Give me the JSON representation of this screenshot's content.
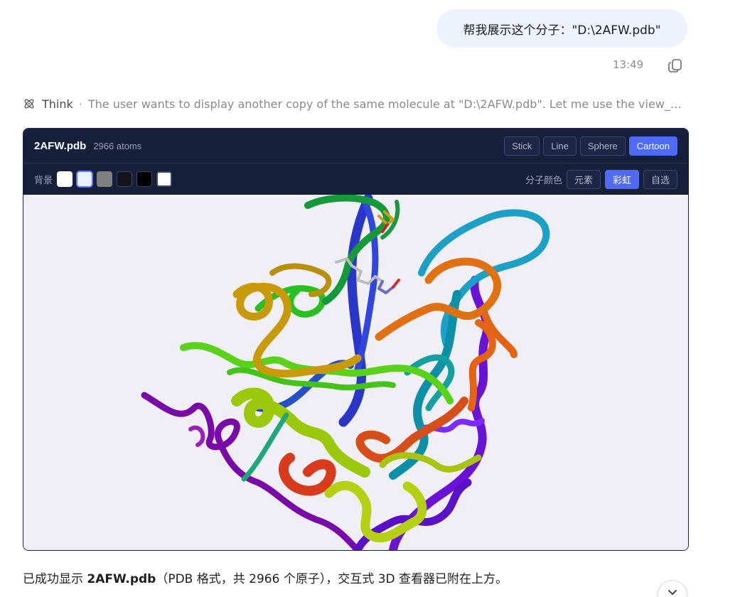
{
  "user_message": "帮我展示这个分子：\"D:\\2AFW.pdb\"",
  "message_time": "13:49",
  "think": {
    "label": "Think",
    "separator": "·",
    "text": "The user wants to display another copy of the same molecule at \"D:\\2AFW.pdb\". Let me use the view_molec..."
  },
  "viewer": {
    "filename": "2AFW.pdb",
    "atoms": "2966 atoms",
    "styles": [
      "Stick",
      "Line",
      "Sphere",
      "Cartoon"
    ],
    "active_style": "Cartoon",
    "background_label": "背景",
    "background_swatches": [
      "#ffffff",
      "#eaf0ff",
      "#808080",
      "#15151c",
      "#000000",
      "#ffffff"
    ],
    "selected_swatch_index": 1,
    "color_label": "分子颜色",
    "color_modes": [
      "元素",
      "彩虹",
      "自选"
    ],
    "active_color_mode": "彩虹"
  },
  "answer": {
    "prefix": "已成功显示 ",
    "filename": "2AFW.pdb",
    "suffix": "（PDB 格式，共 2966 个原子），交互式 3D 查看器已附在上方。"
  }
}
